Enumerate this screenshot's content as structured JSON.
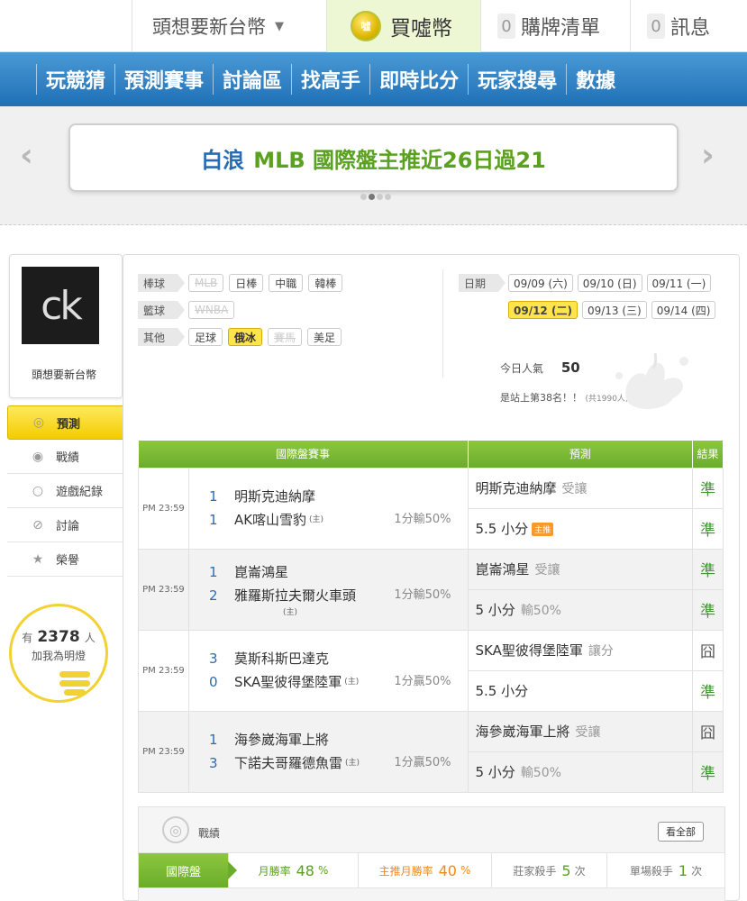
{
  "topbar": {
    "username": "頭想要新台幣",
    "coin_label": "買噓幣",
    "coin_logo": "噓",
    "cart_count": "0",
    "cart_label": "購牌清單",
    "msg_count": "0",
    "msg_label": "訊息"
  },
  "nav": [
    "玩競猜",
    "預測賽事",
    "討論區",
    "找高手",
    "即時比分",
    "玩家搜尋",
    "數據"
  ],
  "banner": {
    "name": "白浪",
    "rest": "MLB 國際盤主推近26日過21",
    "prev_icon": "‹",
    "next_icon": "›"
  },
  "profile": {
    "avatar_text": "ck",
    "name": "頭想要新台幣"
  },
  "side_menu": [
    {
      "label": "預測",
      "icon": "target-icon"
    },
    {
      "label": "戰績",
      "icon": "record-icon"
    },
    {
      "label": "遊戲紀錄",
      "icon": "circle-icon"
    },
    {
      "label": "討論",
      "icon": "discussion-icon"
    },
    {
      "label": "榮譽",
      "icon": "honor-icon"
    }
  ],
  "fans": {
    "prefix": "有",
    "count": "2378",
    "unit": "人",
    "label": "加我為明燈"
  },
  "filters": {
    "baseball": {
      "tag": "棒球",
      "items": [
        "MLB",
        "日棒",
        "中職",
        "韓棒"
      ]
    },
    "basketball": {
      "tag": "籃球",
      "items": [
        "WNBA"
      ]
    },
    "other": {
      "tag": "其他",
      "items": [
        "足球",
        "俄冰",
        "賽馬",
        "美足"
      ]
    }
  },
  "dates": {
    "tag": "日期",
    "row1": [
      "09/09 (六)",
      "09/10 (日)",
      "09/11 (一)"
    ],
    "row2": [
      "09/12 (二)",
      "09/13 (三)",
      "09/14 (四)"
    ]
  },
  "popularity": {
    "label": "今日人氣",
    "value": "50",
    "rank_text": "是站上第38名！！",
    "total": "(共1990人)"
  },
  "table": {
    "headers": [
      "國際盤賽事",
      "預測",
      "結果"
    ],
    "rows": [
      {
        "time": "PM 23:59",
        "away_score": "1",
        "away": "明斯克迪納摩",
        "home_score": "1",
        "home": "AK喀山雪豹",
        "host_mark": "(主)",
        "handicap": "1分輸50%",
        "pred1": "明斯克迪納摩",
        "pred1_note": "受讓",
        "res1": "準",
        "pred2": "5.5 小分",
        "pred2_note": "",
        "pred2_badge": "主推",
        "res2": "準"
      },
      {
        "time": "PM 23:59",
        "away_score": "1",
        "away": "崑崙鴻星",
        "home_score": "2",
        "home": "雅羅斯拉夫爾火車頭",
        "host_mark": "(主)",
        "handicap": "1分輸50%",
        "pred1": "崑崙鴻星",
        "pred1_note": "受讓",
        "res1": "準",
        "pred2": "5 小分",
        "pred2_note": "輸50%",
        "pred2_badge": "",
        "res2": "準"
      },
      {
        "time": "PM 23:59",
        "away_score": "3",
        "away": "莫斯科斯巴達克",
        "home_score": "0",
        "home": "SKA聖彼得堡陸軍",
        "host_mark": "(主)",
        "handicap": "1分贏50%",
        "pred1": "SKA聖彼得堡陸軍",
        "pred1_note": "讓分",
        "res1": "囧",
        "pred2": "5.5 小分",
        "pred2_note": "",
        "pred2_badge": "",
        "res2": "準"
      },
      {
        "time": "PM 23:59",
        "away_score": "1",
        "away": "海參崴海軍上將",
        "home_score": "3",
        "home": "下諾夫哥羅德魚雷",
        "host_mark": "(主)",
        "handicap": "1分贏50%",
        "pred1": "海參崴海軍上將",
        "pred1_note": "受讓",
        "res1": "囧",
        "pred2": "5 小分",
        "pred2_note": "輸50%",
        "pred2_badge": "",
        "res2": "準"
      }
    ]
  },
  "record": {
    "title": "戰績",
    "view_all": "看全部",
    "tab": "國際盤",
    "month_label": "月勝率",
    "month_value": "48",
    "month_unit": "%",
    "host_label": "主推月勝率",
    "host_value": "40",
    "host_unit": "%",
    "banker_label": "莊家殺手",
    "banker_value": "5",
    "banker_unit": "次",
    "single_label": "單場殺手",
    "single_value": "1",
    "single_unit": "次"
  },
  "colors": {
    "nav_blue": "#1f6fb6",
    "accent_green": "#6aad2a",
    "highlight_yellow": "#ffe44d",
    "host_orange": "#f08a1c"
  }
}
